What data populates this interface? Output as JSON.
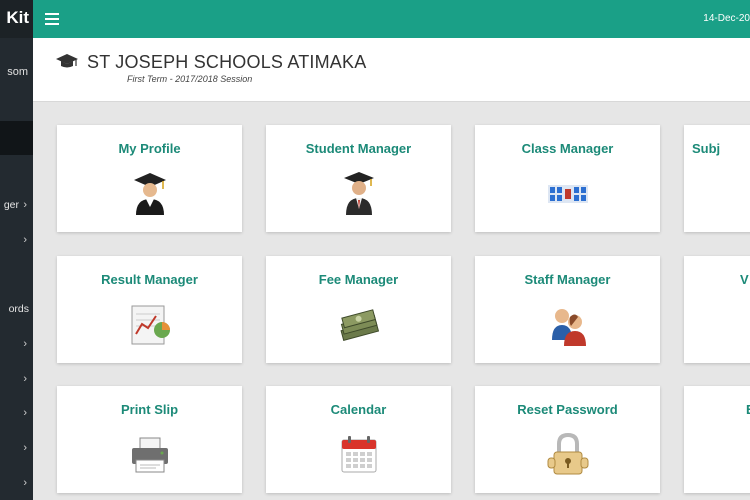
{
  "sidebar": {
    "brand": "Kit",
    "user_name": "som",
    "items": [
      {
        "label": "ger",
        "chevron": "›"
      },
      {
        "label": "",
        "chevron": "›"
      },
      {
        "label": "ords",
        "chevron": ""
      },
      {
        "label": "",
        "chevron": "›"
      },
      {
        "label": "",
        "chevron": "›"
      },
      {
        "label": "",
        "chevron": "›"
      },
      {
        "label": "",
        "chevron": "›"
      },
      {
        "label": "",
        "chevron": "›"
      }
    ]
  },
  "topbar": {
    "date": "14-Dec-20",
    "menu_icon": "hamburger-icon",
    "color": "#1aa087"
  },
  "header": {
    "school_name": "ST JOSEPH SCHOOLS ATIMAKA",
    "session": "First Term - 2017/2018 Session",
    "icon": "graduation-cap-icon"
  },
  "tiles": [
    {
      "title": "My Profile",
      "icon": "graduate-student-icon"
    },
    {
      "title": "Student Manager",
      "icon": "graduate-suit-icon"
    },
    {
      "title": "Class Manager",
      "icon": "classroom-icon"
    },
    {
      "title": "Subj",
      "icon": ""
    },
    {
      "title": "Result Manager",
      "icon": "result-chart-icon"
    },
    {
      "title": "Fee Manager",
      "icon": "money-stack-icon"
    },
    {
      "title": "Staff Manager",
      "icon": "staff-people-icon"
    },
    {
      "title": "V",
      "icon": ""
    },
    {
      "title": "Print Slip",
      "icon": "printer-icon"
    },
    {
      "title": "Calendar",
      "icon": "calendar-icon"
    },
    {
      "title": "Reset Password",
      "icon": "padlock-icon"
    },
    {
      "title": "E",
      "icon": ""
    }
  ],
  "colors": {
    "accent": "#1aa087",
    "tile_title": "#1c8a78",
    "sidebar": "#232a30"
  }
}
